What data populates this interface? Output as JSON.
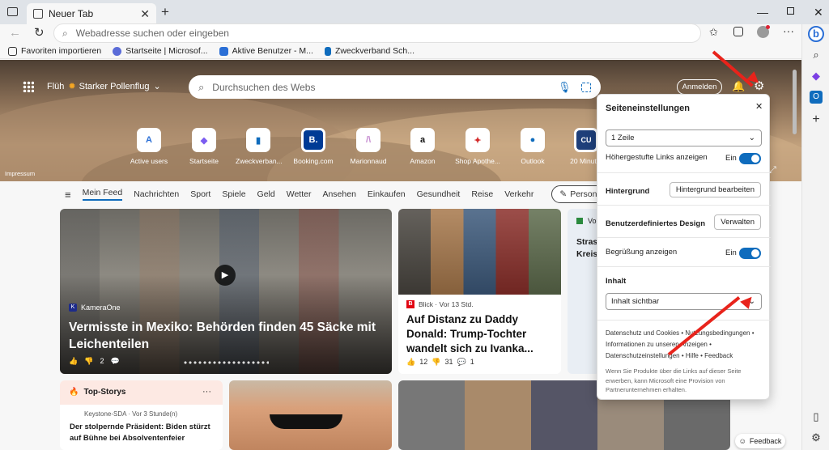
{
  "tab": {
    "title": "Neuer Tab"
  },
  "address": {
    "placeholder": "Webadresse suchen oder eingeben"
  },
  "favorites": [
    {
      "label": "Favoriten importieren"
    },
    {
      "label": "Startseite | Microsof..."
    },
    {
      "label": "Aktive Benutzer - M..."
    },
    {
      "label": "Zweckverband Sch..."
    }
  ],
  "hero": {
    "location": "Flüh",
    "weather": "Starker Pollenflug",
    "search_placeholder": "Durchsuchen des Webs",
    "signin": "Anmelden",
    "impressum": "Impressum"
  },
  "tiles": [
    {
      "label": "Active users",
      "icon": "A",
      "color": "#2b6fd6"
    },
    {
      "label": "Startseite",
      "icon": "◆",
      "color": "#7b5cf0"
    },
    {
      "label": "Zweckverban...",
      "icon": "▮",
      "color": "#0f6cbd"
    },
    {
      "label": "Booking.com",
      "icon": "B.",
      "color": "#003b95"
    },
    {
      "label": "Marionnaud",
      "icon": "/\\",
      "color": "#c58bd0"
    },
    {
      "label": "Amazon",
      "icon": "a",
      "color": "#111111"
    },
    {
      "label": "Shop Apothe...",
      "icon": "✦",
      "color": "#d42b2b"
    },
    {
      "label": "Outlook",
      "icon": "●",
      "color": "#0f6cbd"
    },
    {
      "label": "20 Minut...",
      "icon": "CU",
      "color": "#1e3f7a"
    }
  ],
  "nav": {
    "items": [
      "Mein Feed",
      "Nachrichten",
      "Sport",
      "Spiele",
      "Geld",
      "Wetter",
      "Ansehen",
      "Einkaufen",
      "Gesundheit",
      "Reise",
      "Verkehr"
    ],
    "personalize": "Personalisieren"
  },
  "cards": {
    "main": {
      "source": "KameraOne",
      "headline": "Vermisste in Mexiko: Behörden finden 45 Säcke mit Leichenteilen",
      "likes": "",
      "dislikes": "2"
    },
    "second": {
      "source": "Blick · Vor 13 Std.",
      "headline": "Auf Distanz zu Daddy Donald: Trump-Tochter wandelt sich zu Ivanka...",
      "likes": "12",
      "dislikes": "31",
      "comments": "1"
    },
    "third": {
      "partial_title_1": "Strass",
      "partial_title_2": "Kreis",
      "source_prefix": "Vo"
    },
    "top": {
      "title": "Top-Storys",
      "source": "Keystone-SDA · Vor 3 Stunde(n)",
      "headline": "Der stolpernde Präsident: Biden stürzt auf Bühne bei Absolventenfeier"
    }
  },
  "settings": {
    "title": "Seiteneinstellungen",
    "layout_value": "1 Zeile",
    "links_label": "Höhergestufte Links anzeigen",
    "links_state": "Ein",
    "background_label": "Hintergrund",
    "background_button": "Hintergrund bearbeiten",
    "design_label": "Benutzerdefiniertes Design",
    "design_button": "Verwalten",
    "greeting_label": "Begrüßung anzeigen",
    "greeting_state": "Ein",
    "content_label": "Inhalt",
    "content_value": "Inhalt sichtbar",
    "links_text": "Datenschutz und Cookies • Nutzungsbedingungen • Informationen zu unseren Anzeigen • Datenschutzeinstellungen • Hilfe • Feedback",
    "disclaimer": "Wenn Sie Produkte über die Links auf dieser Seite erwerben, kann Microsoft eine Provision von Partnerunternehmen erhalten."
  },
  "feedback": "Feedback",
  "colors": {
    "accent": "#0f6cbd",
    "arrow": "#e8231b"
  }
}
